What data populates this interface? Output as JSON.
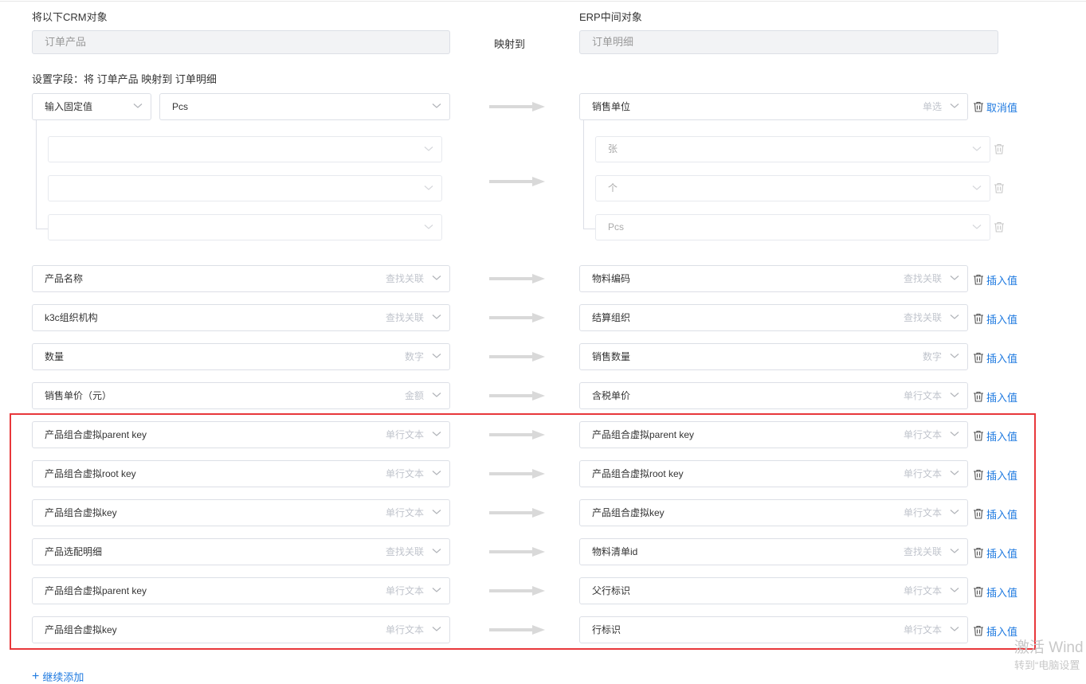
{
  "header": {
    "crm_label": "将以下CRM对象",
    "crm_object": "订单产品",
    "maps_to": "映射到",
    "erp_label": "ERP中间对象",
    "erp_object": "订单明细"
  },
  "field_setting_label": "设置字段：将 订单产品 映射到 订单明细",
  "fixed_mapping": {
    "mode": "输入固定值",
    "value": "Pcs",
    "target": "销售单位",
    "target_type": "单选",
    "action": "取消值",
    "options": [
      {
        "source": "",
        "target": "张"
      },
      {
        "source": "",
        "target": "个"
      },
      {
        "source": "",
        "target": "Pcs"
      }
    ]
  },
  "rows": [
    {
      "src": "产品名称",
      "src_type": "查找关联",
      "dst": "物料编码",
      "dst_type": "查找关联",
      "action": "插入值"
    },
    {
      "src": "k3c组织机构",
      "src_type": "查找关联",
      "dst": "结算组织",
      "dst_type": "查找关联",
      "action": "插入值"
    },
    {
      "src": "数量",
      "src_type": "数字",
      "dst": "销售数量",
      "dst_type": "数字",
      "action": "插入值"
    },
    {
      "src": "销售单价（元）",
      "src_type": "金额",
      "dst": "含税单价",
      "dst_type": "单行文本",
      "action": "插入值"
    },
    {
      "src": "产品组合虚拟parent key",
      "src_type": "单行文本",
      "dst": "产品组合虚拟parent key",
      "dst_type": "单行文本",
      "action": "插入值"
    },
    {
      "src": "产品组合虚拟root key",
      "src_type": "单行文本",
      "dst": "产品组合虚拟root key",
      "dst_type": "单行文本",
      "action": "插入值"
    },
    {
      "src": "产品组合虚拟key",
      "src_type": "单行文本",
      "dst": "产品组合虚拟key",
      "dst_type": "单行文本",
      "action": "插入值"
    },
    {
      "src": "产品选配明细",
      "src_type": "查找关联",
      "dst": "物料清单id",
      "dst_type": "查找关联",
      "action": "插入值"
    },
    {
      "src": "产品组合虚拟parent key",
      "src_type": "单行文本",
      "dst": "父行标识",
      "dst_type": "单行文本",
      "action": "插入值"
    },
    {
      "src": "产品组合虚拟key",
      "src_type": "单行文本",
      "dst": "行标识",
      "dst_type": "单行文本",
      "action": "插入值"
    }
  ],
  "add_more": "继续添加",
  "watermark": {
    "line1": "激活 Wind",
    "line2": "转到“电脑设置"
  },
  "colors": {
    "link": "#1f7ae0",
    "highlight": "#e8373b",
    "arrow": "#d9d9d9",
    "border": "#dcdfe6"
  }
}
